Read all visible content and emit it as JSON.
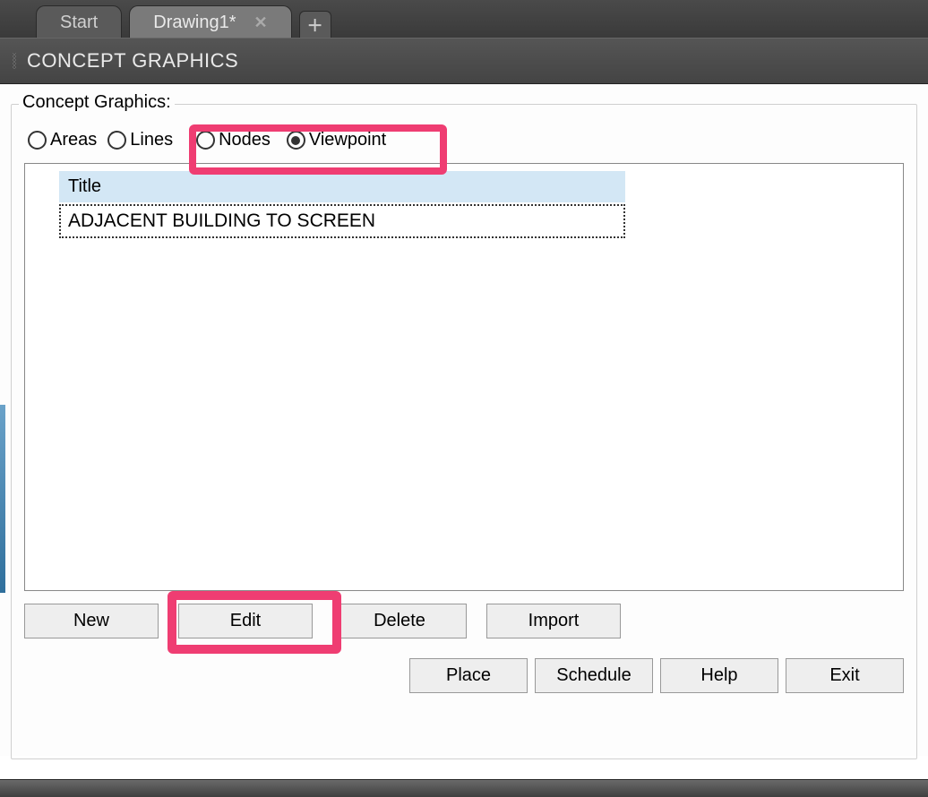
{
  "tabs": {
    "start": "Start",
    "drawing": "Drawing1*"
  },
  "windowTitle": "CONCEPT GRAPHICS",
  "group": {
    "title": "Concept Graphics:",
    "radios": {
      "areas": "Areas",
      "lines": "Lines",
      "nodes": "Nodes",
      "viewpoint": "Viewpoint",
      "selected": "viewpoint"
    }
  },
  "list": {
    "header": "Title",
    "rows": [
      "ADJACENT BUILDING TO SCREEN"
    ]
  },
  "buttons": {
    "new": "New",
    "edit": "Edit",
    "delete": "Delete",
    "import": "Import",
    "place": "Place",
    "schedule": "Schedule",
    "help": "Help",
    "exit": "Exit"
  }
}
